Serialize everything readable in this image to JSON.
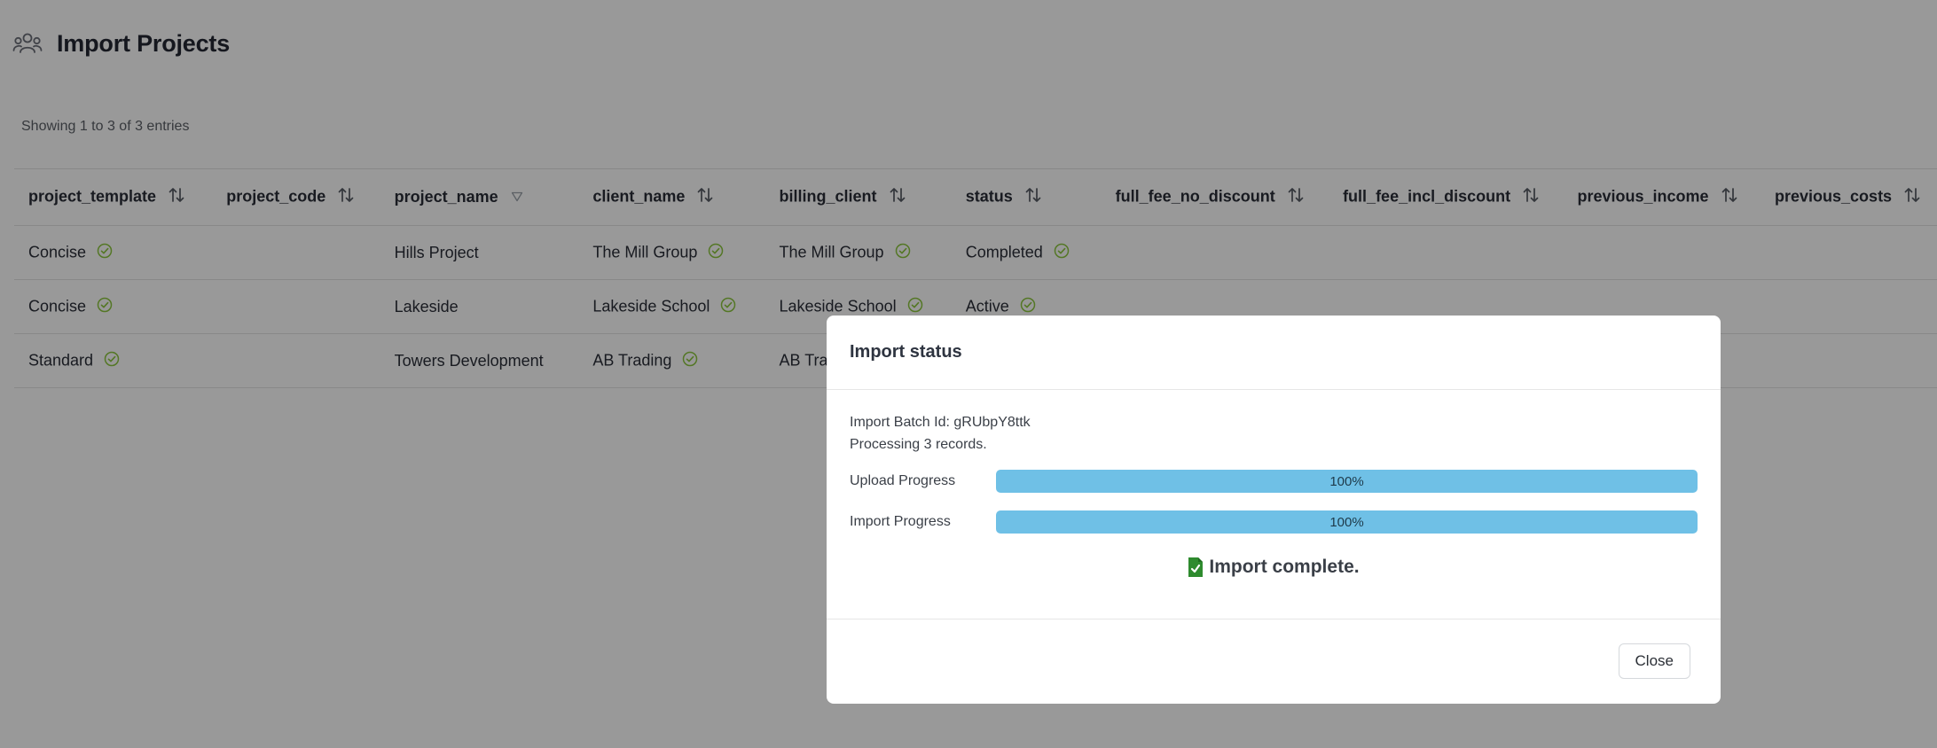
{
  "header": {
    "title": "Import Projects",
    "icon": "users-icon"
  },
  "entries_info": "Showing 1 to 3 of 3 entries",
  "table": {
    "columns": [
      "project_template",
      "project_code",
      "project_name",
      "client_name",
      "billing_client",
      "status",
      "full_fee_no_discount",
      "full_fee_incl_discount",
      "previous_income",
      "previous_costs"
    ],
    "rows": [
      [
        "Concise",
        "",
        "Hills Project",
        "The Mill Group",
        "The Mill Group",
        "Completed",
        "",
        "",
        "",
        ""
      ],
      [
        "Concise",
        "",
        "Lakeside",
        "Lakeside School",
        "Lakeside School",
        "Active",
        "",
        "",
        "",
        ""
      ],
      [
        "Standard",
        "",
        "Towers Development",
        "AB Trading",
        "AB Trading",
        "",
        "",
        "",
        "",
        ""
      ]
    ]
  },
  "modal": {
    "title": "Import status",
    "batch_id": "Import Batch Id: gRUbpY8ttk",
    "processing": "Processing 3 records.",
    "upload": {
      "label": "Upload Progress",
      "value": 1.0,
      "text": "100%"
    },
    "import": {
      "label": "Import Progress",
      "value": 1.0,
      "text": "100%"
    },
    "complete_text": "Import complete.",
    "close_label": "Close"
  },
  "colors": {
    "progress_fill": "#6fc0e6",
    "check_green": "#8cc63f",
    "complete_icon": "#2e8b2e"
  }
}
